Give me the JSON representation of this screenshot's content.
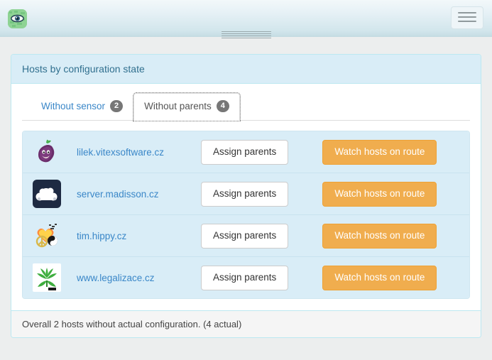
{
  "navbar": {
    "brand_icon": "eye-logo-icon",
    "toggle_label": "Toggle navigation",
    "toggle_icon": "hamburger-icon"
  },
  "panel": {
    "title": "Hosts by configuration state",
    "footer_text": "Overall 2 hosts without actual configuration. (4 actual)"
  },
  "tabs": [
    {
      "label": "Without sensor",
      "badge": "2",
      "active": false
    },
    {
      "label": "Without parents",
      "badge": "4",
      "active": true
    }
  ],
  "hosts": [
    {
      "name": "lilek.vitexsoftware.cz",
      "icon": "eggplant-favicon",
      "assign_label": "Assign parents",
      "watch_label": "Watch hosts on route"
    },
    {
      "name": "server.madisson.cz",
      "icon": "cloud-favicon",
      "assign_label": "Assign parents",
      "watch_label": "Watch hosts on route"
    },
    {
      "name": "tim.hippy.cz",
      "icon": "hippy-favicon",
      "assign_label": "Assign parents",
      "watch_label": "Watch hosts on route"
    },
    {
      "name": "www.legalizace.cz",
      "icon": "cannabis-leaf-favicon",
      "assign_label": "Assign parents",
      "watch_label": "Watch hosts on route"
    }
  ],
  "colors": {
    "panel_border": "#bce8f1",
    "panel_heading_bg": "#d9edf7",
    "heading_text": "#31708f",
    "link": "#3a87c8",
    "warning_btn": "#f0ad4e",
    "badge_bg": "#777777",
    "list_item_bg": "#d9edf7",
    "page_bg": "#eceeee"
  }
}
